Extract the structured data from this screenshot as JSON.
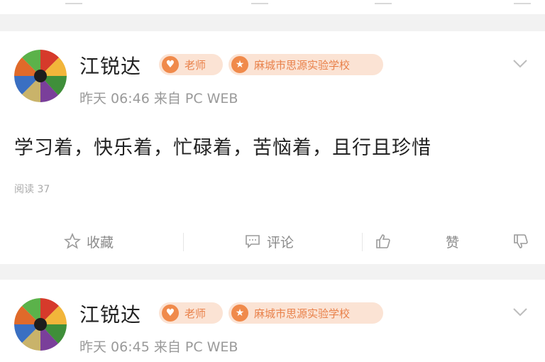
{
  "posts": [
    {
      "author": "江锐达",
      "role_badge": "老师",
      "school_badge": "麻城市思源实验学校",
      "meta": "昨天 06:46 来自 PC WEB",
      "content": "学习着，快乐着，忙碌着，苦恼着，且行且珍惜",
      "reads": "阅读 37",
      "actions": {
        "favorite": "收藏",
        "comment": "评论",
        "like": "赞"
      }
    },
    {
      "author": "江锐达",
      "role_badge": "老师",
      "school_badge": "麻城市思源实验学校",
      "meta": "昨天 06:45 来自 PC WEB"
    }
  ],
  "colors": {
    "accent": "#f08a4b",
    "badge_bg": "#fbe3d4",
    "badge_text": "#e9814a",
    "meta_text": "#9a9a9a"
  },
  "icons": [
    "avatar-image",
    "heart-badge-icon",
    "star-badge-icon",
    "chevron-down-icon",
    "star-icon",
    "comment-icon",
    "thumbs-up-icon",
    "thumbs-down-icon"
  ]
}
